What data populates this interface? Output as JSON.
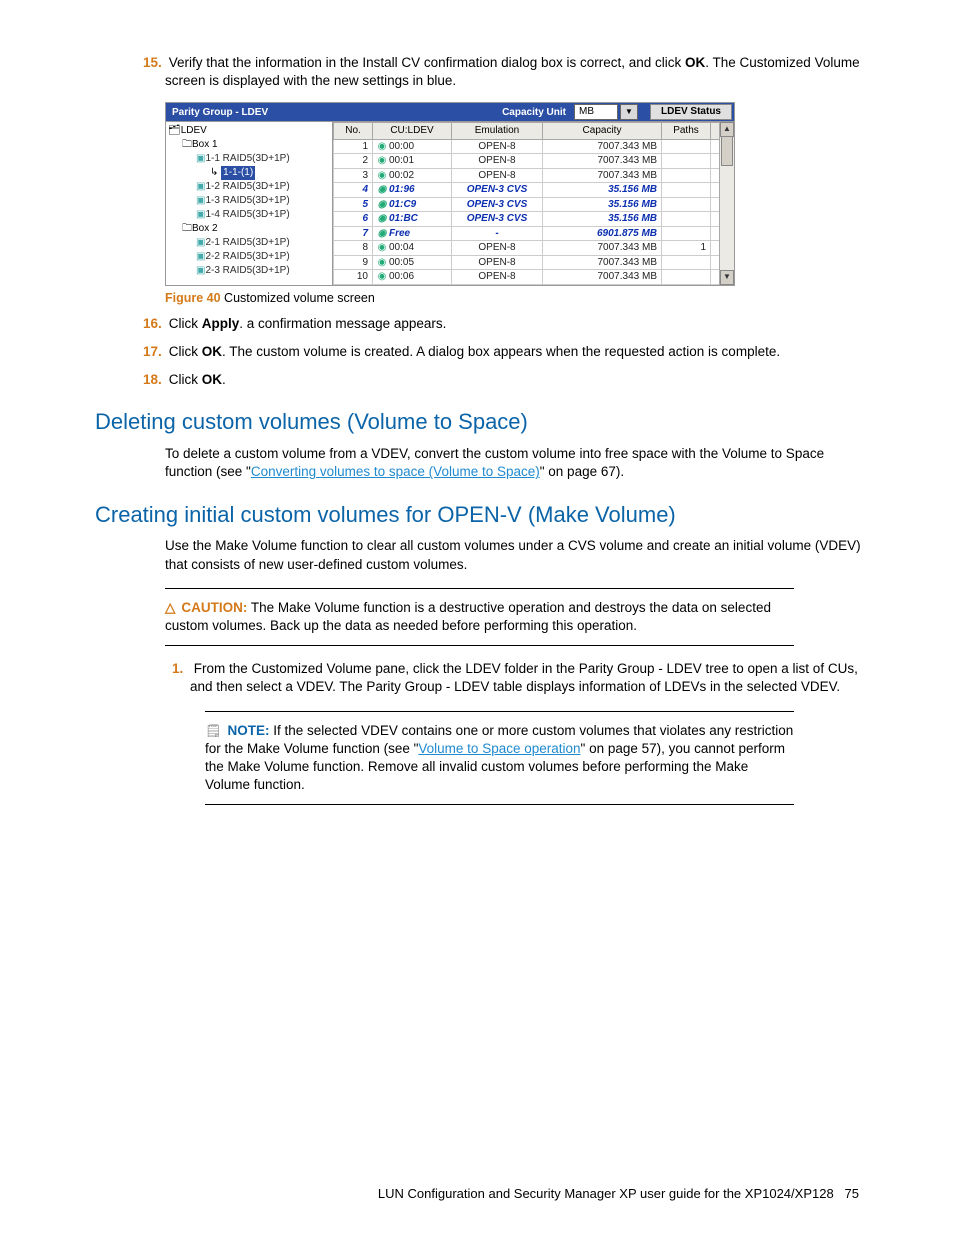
{
  "step15": {
    "num": "15.",
    "text_a": "Verify that the information in the Install CV confirmation dialog box is correct, and click ",
    "ok": "OK",
    "text_b": ". The Customized Volume screen is displayed with the new settings in blue."
  },
  "figure": {
    "header": {
      "title": "Parity Group - LDEV",
      "capacity_unit_label": "Capacity Unit",
      "capacity_unit_value": "MB",
      "status_btn": "LDEV Status"
    },
    "tree": {
      "root": "LDEV",
      "box1": "Box 1",
      "b1_items": [
        "1-1 RAID5(3D+1P)",
        "1-2 RAID5(3D+1P)",
        "1-3 RAID5(3D+1P)",
        "1-4 RAID5(3D+1P)"
      ],
      "selected": "1-1-(1)",
      "box2": "Box 2",
      "b2_items": [
        "2-1 RAID5(3D+1P)",
        "2-2 RAID5(3D+1P)",
        "2-3 RAID5(3D+1P)"
      ]
    },
    "columns": {
      "no": "No.",
      "culdev": "CU:LDEV",
      "emu": "Emulation",
      "cap": "Capacity",
      "paths": "Paths"
    },
    "rows": [
      {
        "no": "1",
        "cu": "00:00",
        "emu": "OPEN-8",
        "cap": "7007.343 MB",
        "paths": "",
        "cls": ""
      },
      {
        "no": "2",
        "cu": "00:01",
        "emu": "OPEN-8",
        "cap": "7007.343 MB",
        "paths": "",
        "cls": ""
      },
      {
        "no": "3",
        "cu": "00:02",
        "emu": "OPEN-8",
        "cap": "7007.343 MB",
        "paths": "",
        "cls": ""
      },
      {
        "no": "4",
        "cu": "01:96",
        "emu": "OPEN-3 CVS",
        "cap": "35.156 MB",
        "paths": "",
        "cls": "cvs"
      },
      {
        "no": "5",
        "cu": "01:C9",
        "emu": "OPEN-3 CVS",
        "cap": "35.156 MB",
        "paths": "",
        "cls": "cvs"
      },
      {
        "no": "6",
        "cu": "01:BC",
        "emu": "OPEN-3 CVS",
        "cap": "35.156 MB",
        "paths": "",
        "cls": "cvs"
      },
      {
        "no": "7",
        "cu": "Free",
        "emu": "-",
        "cap": "6901.875 MB",
        "paths": "",
        "cls": "free"
      },
      {
        "no": "8",
        "cu": "00:04",
        "emu": "OPEN-8",
        "cap": "7007.343 MB",
        "paths": "1",
        "cls": ""
      },
      {
        "no": "9",
        "cu": "00:05",
        "emu": "OPEN-8",
        "cap": "7007.343 MB",
        "paths": "",
        "cls": ""
      },
      {
        "no": "10",
        "cu": "00:06",
        "emu": "OPEN-8",
        "cap": "7007.343 MB",
        "paths": "",
        "cls": ""
      }
    ]
  },
  "fig_caption": {
    "label": "Figure 40",
    "text": "  Customized volume screen"
  },
  "step16": {
    "num": "16.",
    "a": "Click ",
    "apply": "Apply",
    "b": ". a confirmation message appears."
  },
  "step17": {
    "num": "17.",
    "a": "Click ",
    "ok": "OK",
    "b": ". The custom volume is created. A dialog box appears when the requested action is complete."
  },
  "step18": {
    "num": "18.",
    "a": "Click ",
    "ok": "OK",
    "b": "."
  },
  "h_delete": "Deleting custom volumes (Volume to Space)",
  "p_delete": {
    "a": "To delete a custom volume from a VDEV, convert the custom volume into free space with the Volume to Space function (see \"",
    "link": "Converting volumes to space (Volume to Space)",
    "b": "\" on page 67)."
  },
  "h_create": "Creating initial custom volumes for OPEN-V (Make Volume)",
  "p_create": "Use the Make Volume function to clear all custom volumes under a CVS volume and create an initial volume (VDEV) that consists of new user-defined custom volumes.",
  "caution": {
    "label": "CAUTION:",
    "text": "  The Make Volume function is a destructive operation and destroys the data on selected custom volumes. Back up the data as needed before performing this operation."
  },
  "substep1": {
    "num": "1.",
    "text": "From the Customized Volume pane, click the LDEV folder in the Parity Group - LDEV tree to open a list of CUs, and then select a VDEV. The Parity Group - LDEV table displays information of LDEVs in the selected VDEV."
  },
  "note": {
    "label": "NOTE:",
    "a": "  If the selected VDEV contains one or more custom volumes that violates any restriction for the Make Volume function (see \"",
    "link": "Volume to Space operation",
    "b": "\" on page 57), you cannot perform the Make Volume function. Remove all invalid custom volumes before performing the Make Volume function."
  },
  "footer": {
    "text": "LUN Configuration and Security Manager XP user guide for the XP1024/XP128",
    "page": "75"
  }
}
